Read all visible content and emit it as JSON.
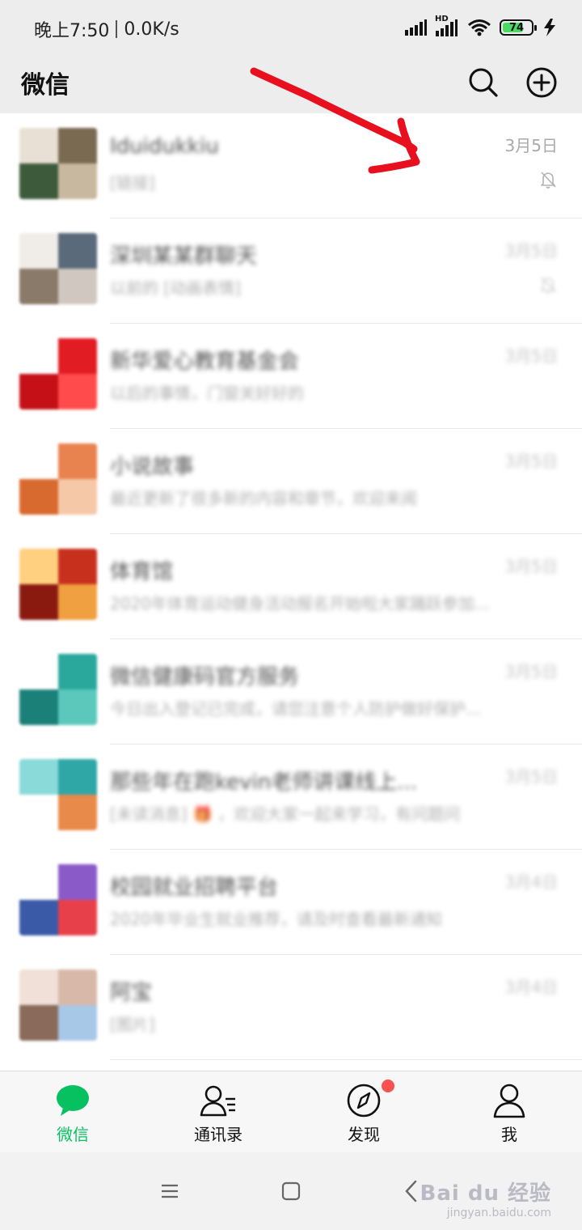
{
  "status_bar": {
    "time": "晚上7:50",
    "network_speed": "0.0K/s",
    "hd_label": "HD",
    "battery_level": "74",
    "battery_percent": 74
  },
  "header": {
    "title": "微信",
    "search_icon": "search-icon",
    "add_icon": "plus-circle-icon"
  },
  "chats": [
    {
      "name": "Iduidukkiu",
      "preview": "[链接]",
      "time": "3月5日",
      "muted": true,
      "avatar_colors": [
        "#7a6a52",
        "#c9b8a0",
        "#3d5a3a",
        "#e8e0d4"
      ]
    },
    {
      "name": "深圳某某群聊天",
      "preview": "以前的 [动画表情]",
      "time": "3月5日",
      "muted": true,
      "avatar_colors": [
        "#5a6a7a",
        "#d0c8c0",
        "#8a7a6a",
        "#f0ece8"
      ]
    },
    {
      "name": "新华爱心教育基金会",
      "preview": "以后的事情，门窗关好好的",
      "time": "3月5日",
      "muted": false,
      "avatar_colors": [
        "#e21c23",
        "#ff4b4b",
        "#c41016",
        "#ffffff"
      ]
    },
    {
      "name": "小说故事",
      "preview": "最近更新了很多新的内容和章节，欢迎来阅",
      "time": "3月5日",
      "muted": false,
      "avatar_colors": [
        "#e8834f",
        "#f5c8a8",
        "#d86a30",
        "#ffffff"
      ]
    },
    {
      "name": "体育馆",
      "preview": "2020年体育运动健身活动报名开始啦大家踊跃参加...",
      "time": "3月5日",
      "muted": false,
      "avatar_colors": [
        "#c8301e",
        "#f0a040",
        "#8a1a10",
        "#ffd080"
      ]
    },
    {
      "name": "微信健康码官方服务",
      "preview": "今日出入登记已完成，请您注意个人防护做好保护...",
      "time": "3月5日",
      "muted": false,
      "avatar_colors": [
        "#2aa89c",
        "#5cc8bc",
        "#1a8078",
        "#ffffff"
      ]
    },
    {
      "name": "那些年在跑kevin老师讲课线上...",
      "preview": "[未读消息] 🎁 ，欢迎大家一起来学习，有问题问",
      "time": "3月5日",
      "muted": false,
      "avatar_colors": [
        "#2fa7a7",
        "#e88a4a",
        "#ffffff",
        "#8adada"
      ]
    },
    {
      "name": "校园就业招聘平台",
      "preview": "2020年毕业生就业推荐，请及时查看最新通知",
      "time": "3月4日",
      "muted": false,
      "avatar_colors": [
        "#8a5ac8",
        "#e8404a",
        "#3a5aa8",
        "#ffffff"
      ]
    },
    {
      "name": "阿宝",
      "preview": "[图片]",
      "time": "3月4日",
      "muted": false,
      "avatar_colors": [
        "#d8b8a8",
        "#a8c8e8",
        "#8a6a5a",
        "#f0e0d8"
      ]
    }
  ],
  "tabs": [
    {
      "label": "微信",
      "icon": "chat-bubble-icon",
      "active": true,
      "badge": false
    },
    {
      "label": "通讯录",
      "icon": "contacts-icon",
      "active": false,
      "badge": false
    },
    {
      "label": "发现",
      "icon": "compass-icon",
      "active": false,
      "badge": true
    },
    {
      "label": "我",
      "icon": "person-icon",
      "active": false,
      "badge": false
    }
  ],
  "watermark": {
    "main": "Bai du 经验",
    "sub": "jingyan.baidu.com"
  },
  "colors": {
    "accent": "#07c160",
    "badge": "#fa5151",
    "annotation": "#e8101e"
  }
}
